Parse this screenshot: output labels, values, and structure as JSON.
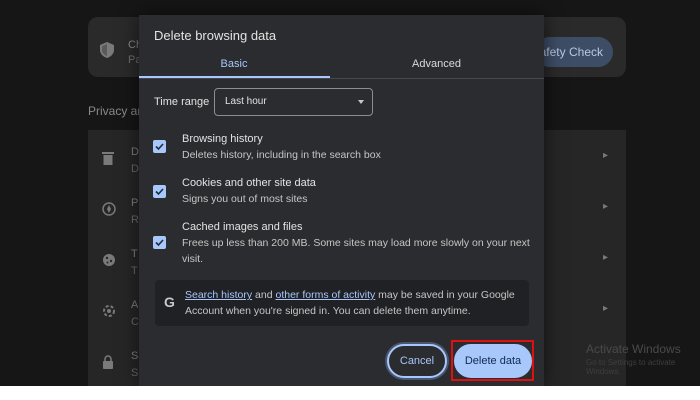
{
  "background": {
    "safety_card": {
      "title": "Ch",
      "subtitle": "Pa",
      "button": "afety Check"
    },
    "section_title": "Privacy an",
    "rows": [
      {
        "icon": "trash-icon",
        "t1": "D",
        "t2": "D"
      },
      {
        "icon": "compass-icon",
        "t1": "P",
        "t2": "R"
      },
      {
        "icon": "cookie-icon",
        "t1": "T",
        "t2": "T"
      },
      {
        "icon": "settings-icon",
        "t1": "A",
        "t2": "C"
      },
      {
        "icon": "lock-icon",
        "t1": "S",
        "t2": "S"
      }
    ],
    "watermark": {
      "line1": "Activate Windows",
      "line2": "Go to Settings to activate Windows."
    }
  },
  "dialog": {
    "title": "Delete browsing data",
    "tabs": {
      "basic": "Basic",
      "advanced": "Advanced"
    },
    "time_range": {
      "label": "Time range",
      "value": "Last hour"
    },
    "options": [
      {
        "title": "Browsing history",
        "desc": "Deletes history, including in the search box",
        "checked": true
      },
      {
        "title": "Cookies and other site data",
        "desc": "Signs you out of most sites",
        "checked": true
      },
      {
        "title": "Cached images and files",
        "desc": "Frees up less than 200 MB. Some sites may load more slowly on your next visit.",
        "checked": true
      }
    ],
    "info": {
      "link1": "Search history",
      "and": " and ",
      "link2": "other forms of activity",
      "rest": " may be saved in your Google Account when you're signed in. You can delete them anytime."
    },
    "buttons": {
      "cancel": "Cancel",
      "delete": "Delete data"
    }
  },
  "colors": {
    "accent": "#a8c7fa",
    "dialog_bg": "#2b2c2f",
    "highlight": "#e01010"
  }
}
